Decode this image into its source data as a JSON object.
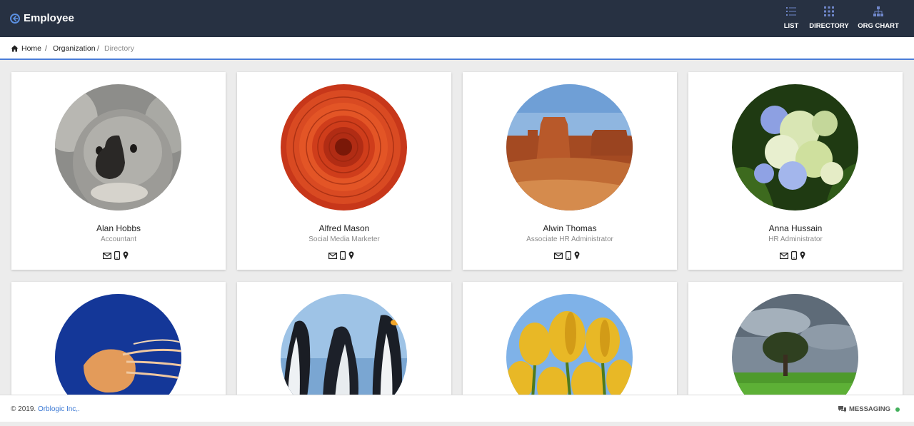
{
  "header": {
    "title": "Employee",
    "nav": [
      {
        "label": "LIST",
        "icon": "list-icon"
      },
      {
        "label": "DIRECTORY",
        "icon": "grid-icon"
      },
      {
        "label": "ORG CHART",
        "icon": "org-chart-icon"
      }
    ],
    "accent": "#5b8fe0",
    "background": "#273142"
  },
  "breadcrumb": {
    "home": "Home",
    "separator": "/",
    "organization": "Organization",
    "current": "Directory"
  },
  "employees": [
    {
      "name": "Alan Hobbs",
      "role": "Accountant",
      "photo": "koala"
    },
    {
      "name": "Alfred Mason",
      "role": "Social Media Marketer",
      "photo": "chrysanthemum"
    },
    {
      "name": "Alwin Thomas",
      "role": "Associate HR Administrator",
      "photo": "desert"
    },
    {
      "name": "Anna Hussain",
      "role": "HR Administrator",
      "photo": "hydrangeas"
    },
    {
      "name": "",
      "role": "",
      "photo": "jellyfish"
    },
    {
      "name": "",
      "role": "",
      "photo": "penguins"
    },
    {
      "name": "",
      "role": "",
      "photo": "tulips"
    },
    {
      "name": "",
      "role": "",
      "photo": "tree"
    }
  ],
  "contact_icons": [
    "mail-icon",
    "mobile-icon",
    "location-icon"
  ],
  "footer": {
    "copyright": "© 2019.",
    "company": "Orblogic Inc,.",
    "messaging": "MESSAGING",
    "status_color": "#43b05c"
  }
}
